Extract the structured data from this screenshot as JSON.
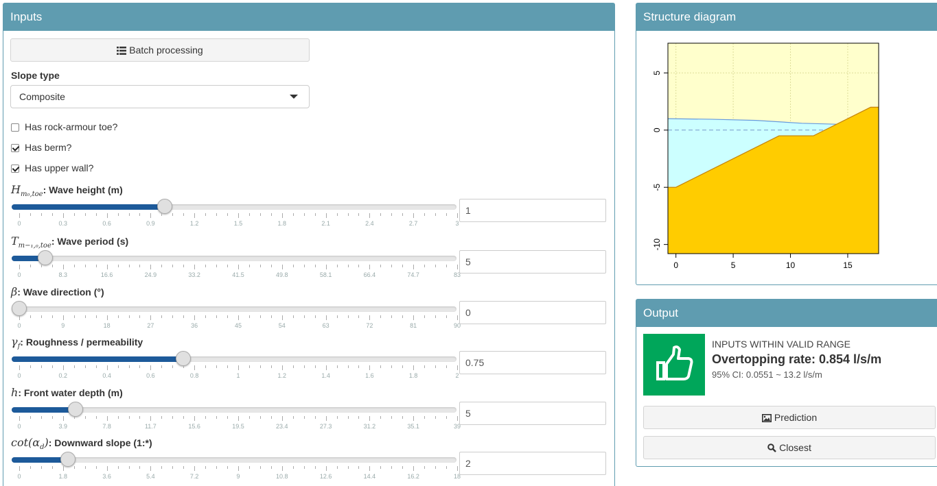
{
  "inputs": {
    "title": "Inputs",
    "batch_label": "Batch processing",
    "slope_type_label": "Slope type",
    "slope_type_value": "Composite",
    "checks": [
      {
        "label": "Has rock-armour toe?",
        "checked": false
      },
      {
        "label": "Has berm?",
        "checked": true
      },
      {
        "label": "Has upper wall?",
        "checked": true
      }
    ],
    "sliders": [
      {
        "math": "H",
        "math_sub": "m₀,toe",
        "label": ": Wave height (m)",
        "value": "1",
        "fraction": 0.333,
        "ticks": [
          "0",
          "0.3",
          "0.6",
          "0.9",
          "1.2",
          "1.5",
          "1.8",
          "2.1",
          "2.4",
          "2.7",
          "3"
        ]
      },
      {
        "math": "T",
        "math_sub": "m−₁,₀,toe",
        "label": ": Wave period (s)",
        "value": "5",
        "fraction": 0.06,
        "ticks": [
          "0",
          "8.3",
          "16.6",
          "24.9",
          "33.2",
          "41.5",
          "49.8",
          "58.1",
          "66.4",
          "74.7",
          "83"
        ]
      },
      {
        "math": "β",
        "math_sub": "",
        "label": ": Wave direction (°)",
        "value": "0",
        "fraction": 0.0,
        "ticks": [
          "0",
          "9",
          "18",
          "27",
          "36",
          "45",
          "54",
          "63",
          "72",
          "81",
          "90"
        ]
      },
      {
        "math": "γ",
        "math_sub": "f",
        "label": ": Roughness / permeability",
        "value": "0.75",
        "fraction": 0.375,
        "ticks": [
          "0",
          "0.2",
          "0.4",
          "0.6",
          "0.8",
          "1",
          "1.2",
          "1.4",
          "1.6",
          "1.8",
          "2"
        ]
      },
      {
        "math": "h",
        "math_sub": "",
        "label": ": Front water depth (m)",
        "value": "5",
        "fraction": 0.128,
        "ticks": [
          "0",
          "3.9",
          "7.8",
          "11.7",
          "15.6",
          "19.5",
          "23.4",
          "27.3",
          "31.2",
          "35.1",
          "39"
        ]
      },
      {
        "math": "cot(α",
        "math_sub": "d",
        "math_tail": ")",
        "label": ": Downward slope (1:*)",
        "value": "2",
        "fraction": 0.111,
        "ticks": [
          "0",
          "1.8",
          "3.6",
          "5.4",
          "7.2",
          "9",
          "10.8",
          "12.6",
          "14.4",
          "16.2",
          "18"
        ]
      }
    ]
  },
  "diagram": {
    "title": "Structure diagram",
    "chart_data": {
      "type": "area",
      "xlim": [
        -0.7,
        17.7
      ],
      "ylim": [
        -10.8,
        7.6
      ],
      "xticks": [
        "0",
        "5",
        "10",
        "15"
      ],
      "yticks": [
        "5",
        "0",
        "-5",
        "-10"
      ],
      "structure_profile": [
        [
          -0.7,
          -5
        ],
        [
          0,
          -5
        ],
        [
          9,
          -0.5
        ],
        [
          12,
          -0.5
        ],
        [
          17,
          2
        ],
        [
          17.7,
          2
        ]
      ],
      "still_water_level": 0,
      "wave_surface": [
        [
          -0.7,
          1
        ],
        [
          3,
          0.95
        ],
        [
          7,
          0.85
        ],
        [
          11,
          0.6
        ],
        [
          14.5,
          0.5
        ]
      ],
      "colors": {
        "sky": "#ffffcc",
        "water": "#ccffff",
        "structure": "#ffcc00",
        "structure_edge": "#c8860a",
        "surface": "#6699dd"
      }
    }
  },
  "output": {
    "title": "Output",
    "status": "INPUTS WITHIN VALID RANGE",
    "rate": "Overtopping rate: 0.854 l/s/m",
    "ci": "95% CI: 0.0551 ~ 13.2 l/s/m",
    "prediction_label": "Prediction",
    "closest_label": "Closest",
    "accent": "#00a65a"
  }
}
